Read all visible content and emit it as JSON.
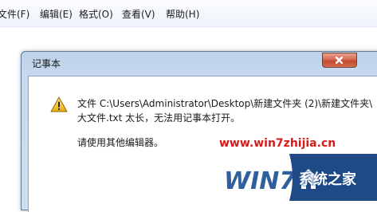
{
  "menu": {
    "items": [
      {
        "label": "文件(F)"
      },
      {
        "label": "编辑(E)"
      },
      {
        "label": "格式(O)"
      },
      {
        "label": "查看(V)"
      },
      {
        "label": "帮助(H)"
      }
    ]
  },
  "dialog": {
    "title": "记事本",
    "icon": "warning-icon",
    "message_line_1": "文件 C:\\Users\\Administrator\\Desktop\\新建文件夹 (2)\\新建文件夹\\",
    "message_line_2": "大文件.txt 太长，无法用记事本打开。",
    "message_line_3": "请使用其他编辑器。"
  },
  "watermark": {
    "url": "www.win7zhijia.cn",
    "logo_text": "WIN7",
    "wordmark": "系统之家"
  },
  "colors": {
    "dialog_frame": "#c7d9ee",
    "close_button": "#d66b53",
    "warning_yellow": "#f3c623",
    "watermark_red": "#d41a1a",
    "watermark_blue": "#1e4a86"
  }
}
